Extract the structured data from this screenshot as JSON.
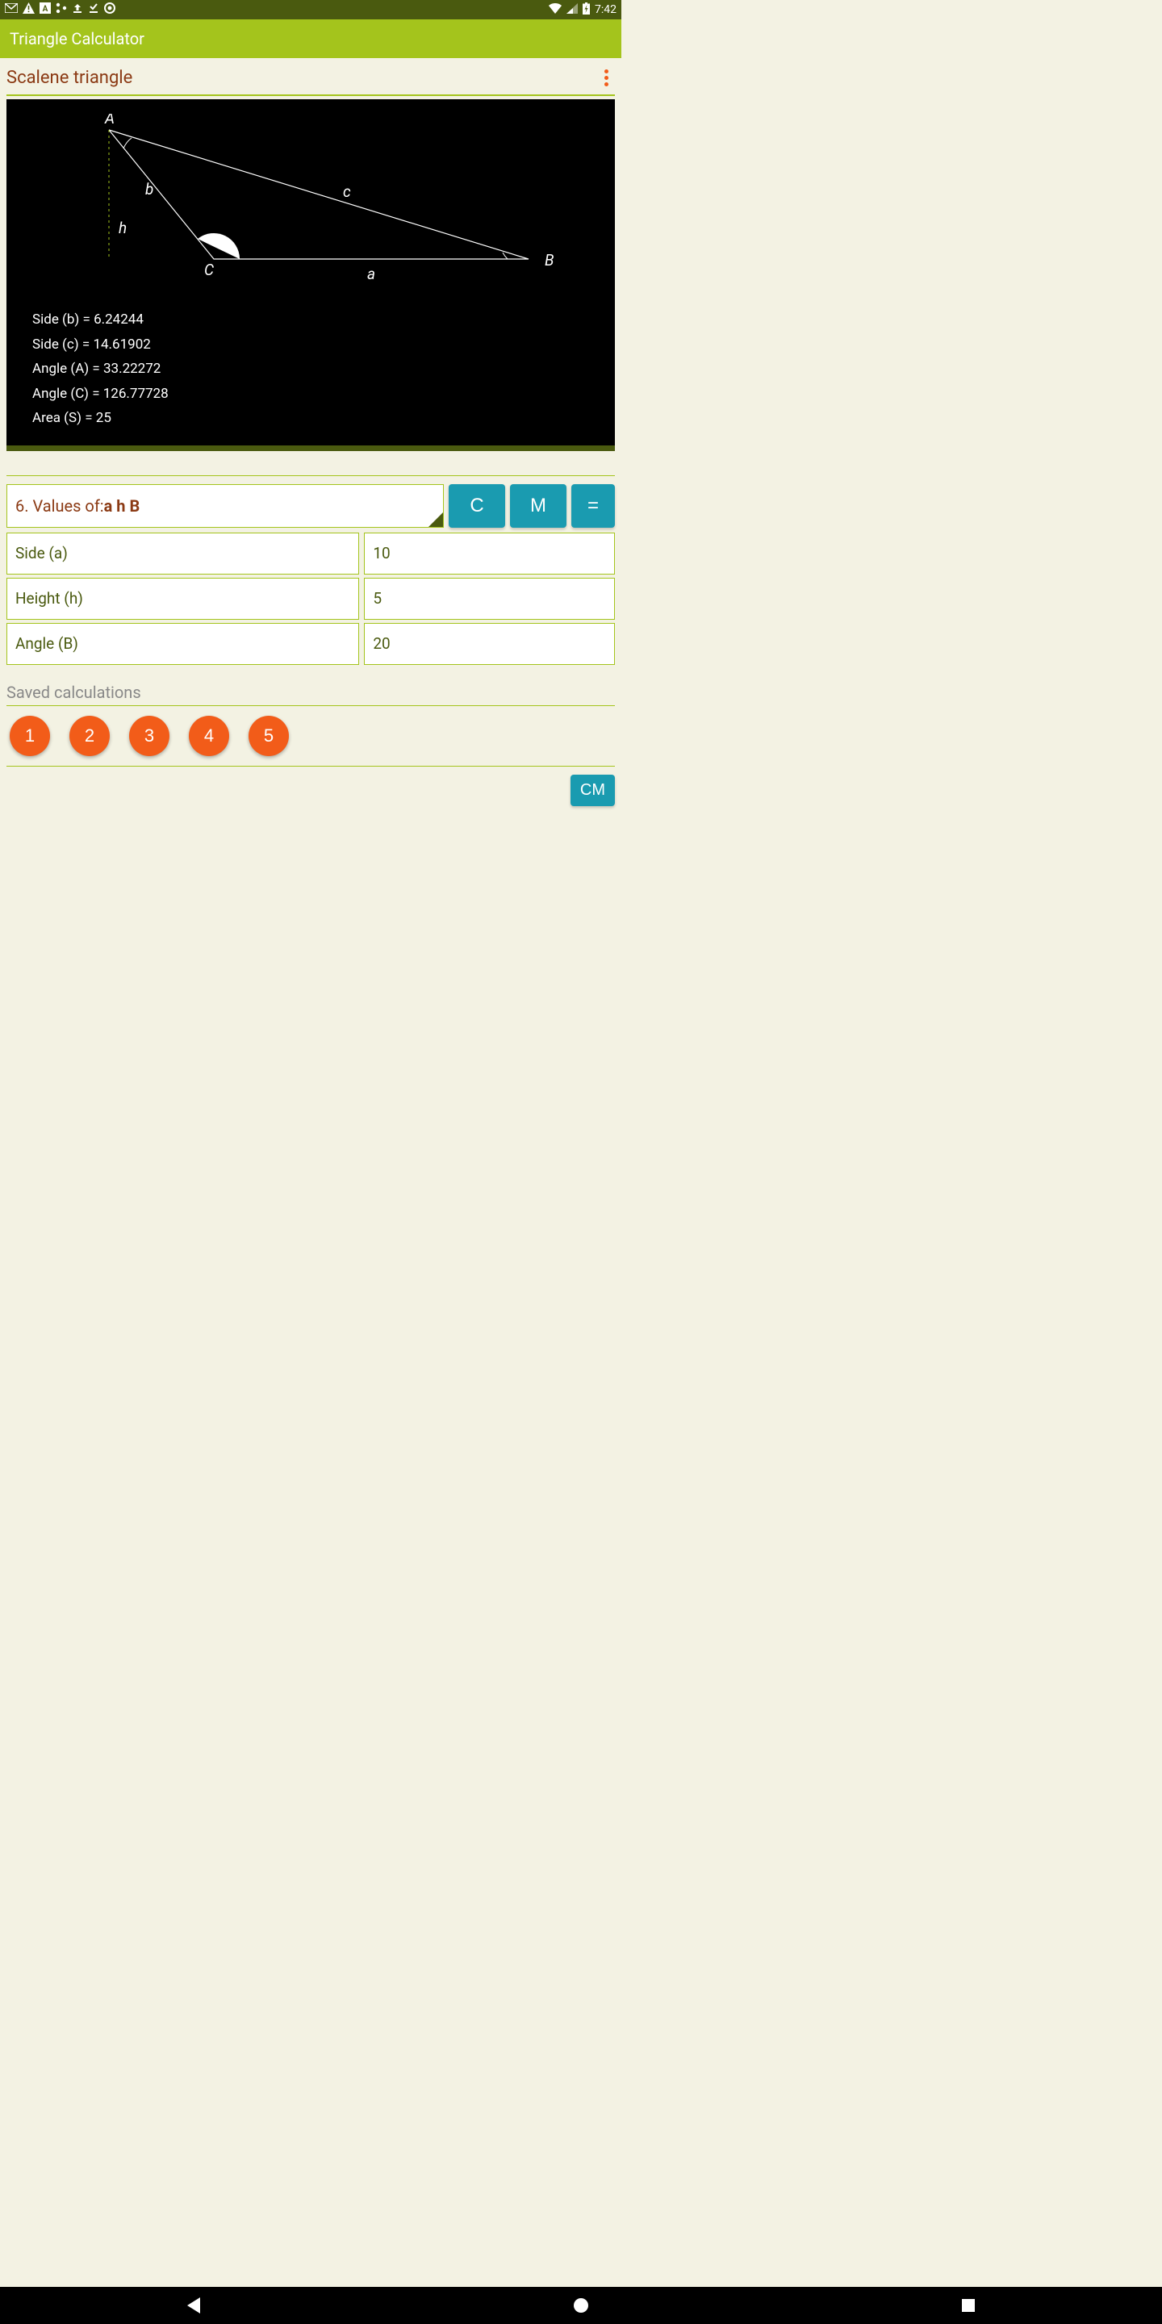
{
  "status": {
    "time": "7:42"
  },
  "app": {
    "title": "Triangle Calculator"
  },
  "subhead": "Scalene triangle",
  "diagram": {
    "labels": {
      "A": "A",
      "B": "B",
      "C": "C",
      "a": "a",
      "b": "b",
      "c": "c",
      "h": "h"
    }
  },
  "results": {
    "side_b": "Side (b) = 6.24244",
    "side_c": "Side (c) = 14.61902",
    "angle_A": "Angle (A) = 33.22272",
    "angle_C": "Angle (C) = 126.77728",
    "area_S": "Area (S) = 25"
  },
  "selector": {
    "prefix": "6. Values of: ",
    "bold": "a h B"
  },
  "buttons": {
    "clear": "C",
    "mem": "M",
    "eq": "="
  },
  "inputs": [
    {
      "label": "Side (a)",
      "value": "10"
    },
    {
      "label": "Height (h)",
      "value": "5"
    },
    {
      "label": "Angle (B)",
      "value": "20"
    }
  ],
  "saved": {
    "label": "Saved calculations",
    "items": [
      "1",
      "2",
      "3",
      "4",
      "5"
    ]
  },
  "unit": "CM"
}
